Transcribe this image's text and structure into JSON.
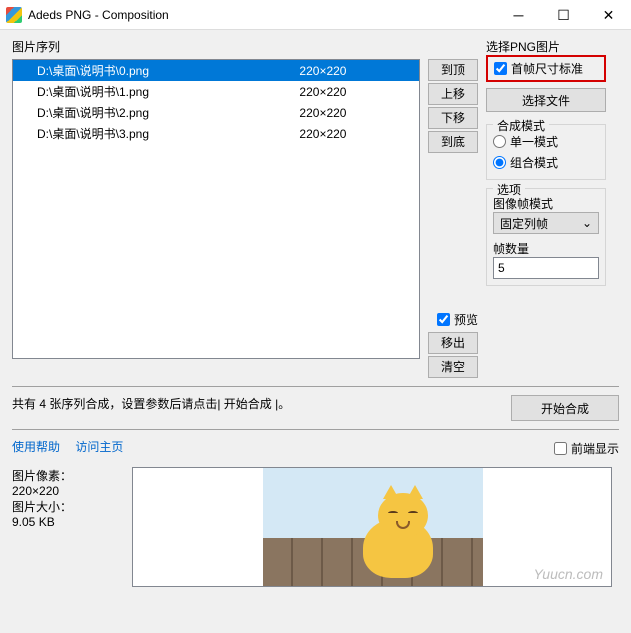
{
  "window": {
    "title": "Adeds PNG - Composition"
  },
  "labels": {
    "sequence": "图片序列",
    "selectPng": "选择PNG图片",
    "firstFrameStd": "首帧尺寸标准",
    "selectFile": "选择文件",
    "composeMode": "合成模式",
    "singleMode": "单一模式",
    "groupMode": "组合模式",
    "options": "选项",
    "frameMode": "图像帧模式",
    "frameCount": "帧数量",
    "preview": "预览",
    "frontDisplay": "前端显示",
    "startCompose": "开始合成",
    "imagePixel": "图片像素：",
    "imageSize": "图片大小：",
    "useHelp": "使用帮助",
    "visitHome": "访问主页"
  },
  "buttons": {
    "toTop": "到顶",
    "moveUp": "上移",
    "moveDown": "下移",
    "toBottom": "到底",
    "moveOut": "移出",
    "clear": "清空"
  },
  "combo": {
    "fixedCol": "固定列帧"
  },
  "values": {
    "frameCount": "5",
    "pixelValue": "220×220",
    "sizeValue": "9.05 KB"
  },
  "list": [
    {
      "path": "D:\\桌面\\说明书\\0.png",
      "dim": "220×220",
      "selected": true
    },
    {
      "path": "D:\\桌面\\说明书\\1.png",
      "dim": "220×220",
      "selected": false
    },
    {
      "path": "D:\\桌面\\说明书\\2.png",
      "dim": "220×220",
      "selected": false
    },
    {
      "path": "D:\\桌面\\说明书\\3.png",
      "dim": "220×220",
      "selected": false
    }
  ],
  "status": {
    "text": "共有 4 张序列合成，设置参数后请点击| 开始合成 |。"
  },
  "watermark": "Yuucn.com"
}
